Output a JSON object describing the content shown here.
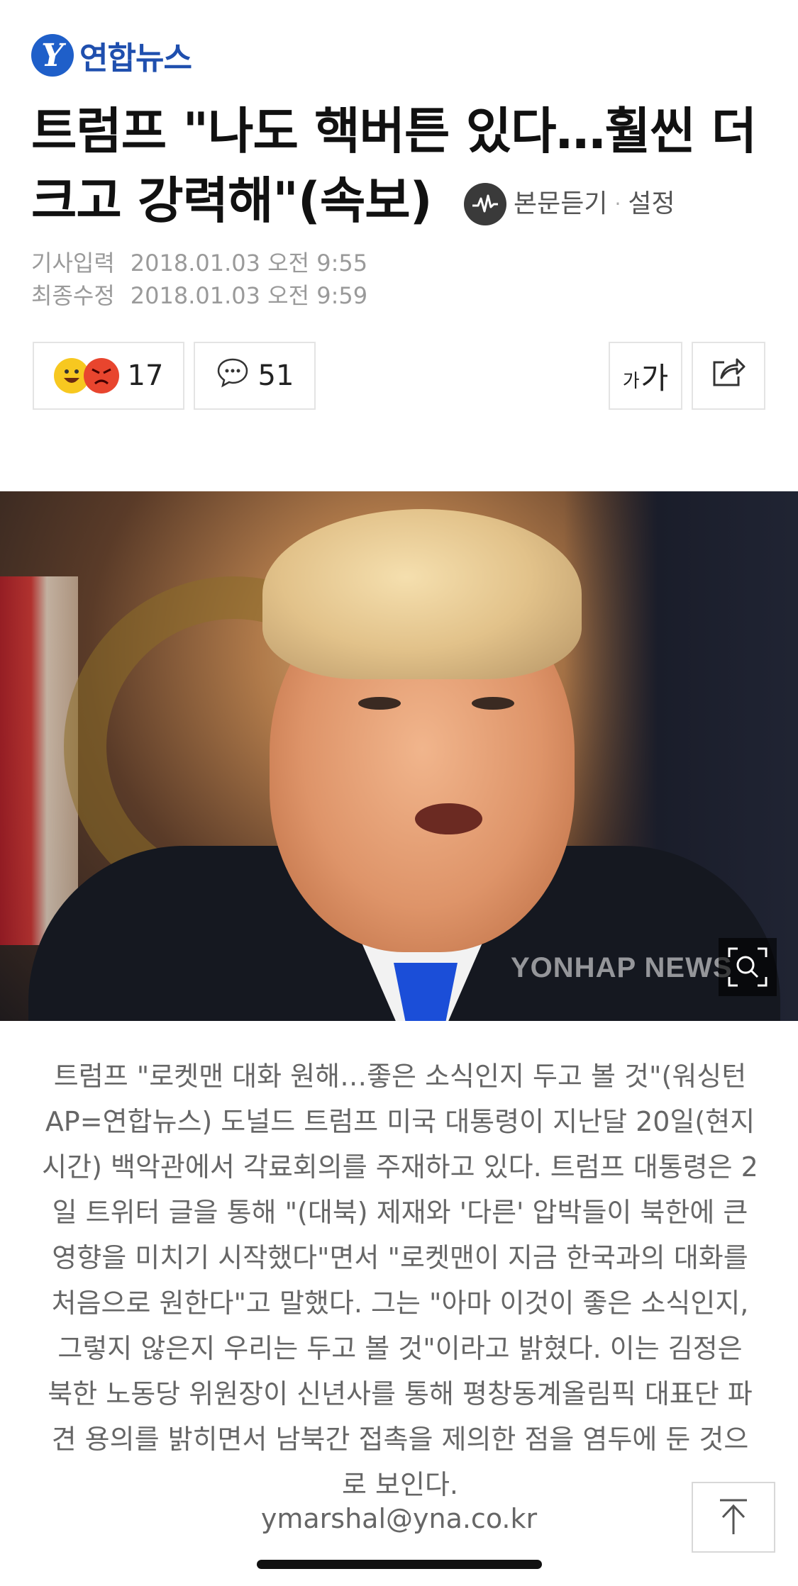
{
  "brand": {
    "logo_letter": "Y",
    "name": "연합뉴스"
  },
  "article": {
    "title": "트럼프 \"나도 핵버튼 있다…훨씬 더 크고 강력해\"(속보)",
    "listen_label": "본문듣기",
    "settings_label": "설정",
    "published_label": "기사입력",
    "published_value": "2018.01.03 오전 9:55",
    "modified_label": "최종수정",
    "modified_value": "2018.01.03 오전 9:59"
  },
  "toolbar": {
    "reaction_count": "17",
    "comment_count": "51",
    "font_size_small": "가",
    "font_size_large": "가"
  },
  "photo": {
    "watermark": "YONHAP NEWS"
  },
  "caption": {
    "text": "트럼프 \"로켓맨 대화 원해…좋은 소식인지 두고 볼 것\"(워싱턴 AP=연합뉴스) 도널드 트럼프 미국 대통령이 지난달 20일(현지시간) 백악관에서 각료회의를 주재하고 있다. 트럼프 대통령은 2일 트위터 글을 통해 \"(대북) 제재와 '다른' 압박들이 북한에 큰 영향을 미치기 시작했다\"면서 \"로켓맨이 지금 한국과의 대화를 처음으로 원한다\"고 말했다. 그는 \"아마 이것이 좋은 소식인지, 그렇지 않은지 우리는 두고 볼 것\"이라고 밝혔다. 이는 김정은 북한 노동당 위원장이 신년사를 통해 평창동계올림픽 대표단 파견 용의를 밝히면서 남북간 접촉을 제의한 점을 염두에 둔 것으로 보인다.",
    "email": "ymarshal@yna.co.kr"
  },
  "colors": {
    "brand_blue": "#1f5fc9",
    "meta_gray": "#9a9a9a",
    "caption_gray": "#666666"
  }
}
